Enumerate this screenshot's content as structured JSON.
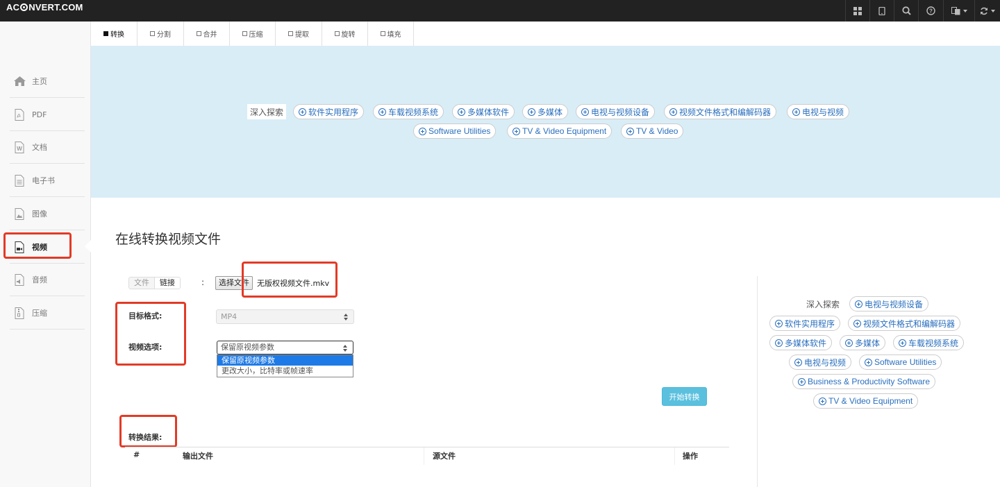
{
  "header": {
    "logo_pre": "AC",
    "logo_post": "NVERT.COM",
    "icons": [
      "grid-icon",
      "tablet-icon",
      "search-icon",
      "help-icon",
      "language-icon",
      "refresh-icon"
    ]
  },
  "sidebar": {
    "items": [
      {
        "label": "主页",
        "icon": "home-icon"
      },
      {
        "label": "PDF",
        "icon": "pdf-icon"
      },
      {
        "label": "文档",
        "icon": "word-document-icon"
      },
      {
        "label": "电子书",
        "icon": "ebook-icon"
      },
      {
        "label": "图像",
        "icon": "image-icon"
      },
      {
        "label": "视频",
        "icon": "video-icon"
      },
      {
        "label": "音频",
        "icon": "audio-icon"
      },
      {
        "label": "压缩",
        "icon": "archive-icon"
      }
    ],
    "active": "视频"
  },
  "tabs": [
    {
      "label": "转换"
    },
    {
      "label": "分割"
    },
    {
      "label": "合并"
    },
    {
      "label": "压缩"
    },
    {
      "label": "提取"
    },
    {
      "label": "旋转"
    },
    {
      "label": "填充"
    }
  ],
  "banner": {
    "explore_label": "深入探索",
    "row1": [
      "软件实用程序",
      "车载视频系统",
      "多媒体软件",
      "多媒体",
      "电视与视频设备",
      "视频文件格式和编解码器",
      "电视与视频"
    ],
    "row2": [
      "Software Utilities",
      "TV & Video Equipment",
      "TV & Video"
    ]
  },
  "main": {
    "title": "在线转换视频文件",
    "source_toggle": {
      "file": "文件",
      "link": "链接"
    },
    "colon": ":",
    "choose_file_button": "选择文件",
    "file_name": "无版权视频文件.mkv",
    "target_format_label": "目标格式:",
    "target_format_value": "MP4",
    "video_options_label": "视频选项:",
    "video_options_value": "保留原视频参数",
    "video_options_list": [
      "保留原视频参数",
      "更改大小，比特率或帧速率"
    ],
    "start_button": "开始转换",
    "result_label": "转换结果:",
    "table_headers": {
      "num": "#",
      "output": "输出文件",
      "source": "源文件",
      "action": "操作"
    }
  },
  "right_panel": {
    "explore_label": "深入探索",
    "tags": [
      "电视与视频设备",
      "软件实用程序",
      "视频文件格式和编解码器",
      "多媒体软件",
      "多媒体",
      "车载视频系统",
      "电视与视频",
      "Software Utilities",
      "Business & Productivity Software",
      "TV & Video Equipment"
    ]
  },
  "colors": {
    "topbar": "#222222",
    "banner": "#d9edf7",
    "link": "#2a6fbe",
    "start_button": "#5bc0de",
    "highlight": "#e23a26",
    "selected_option": "#1e7ae6"
  }
}
